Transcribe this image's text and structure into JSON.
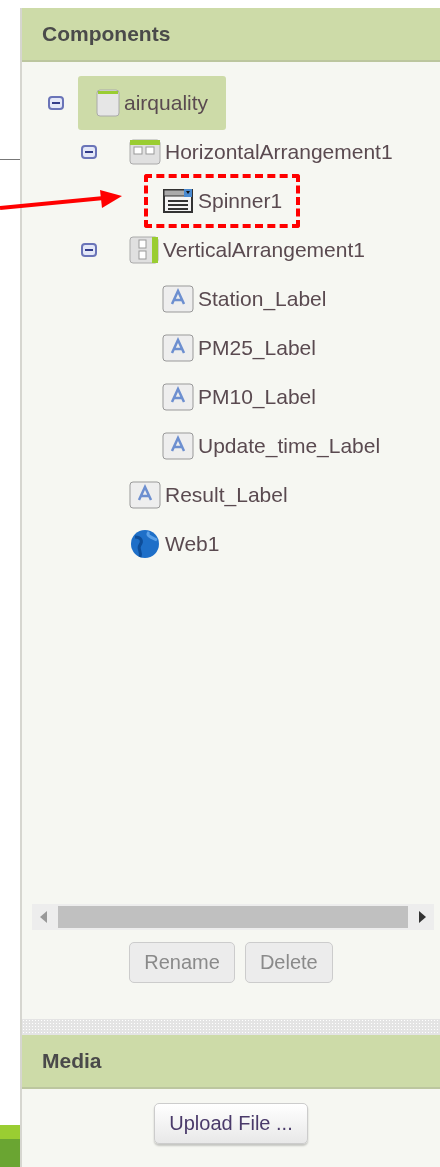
{
  "components": {
    "title": "Components",
    "tree": [
      {
        "label": "airquality",
        "kind": "screen",
        "selected": true,
        "expanded": true,
        "annotated": false,
        "children": [
          {
            "label": "HorizontalArrangement1",
            "kind": "horizontal",
            "selected": false,
            "expanded": true,
            "annotated": false,
            "children": [
              {
                "label": "Spinner1",
                "kind": "spinner",
                "selected": false,
                "annotated": true
              }
            ]
          },
          {
            "label": "VerticalArrangement1",
            "kind": "vertical",
            "selected": false,
            "expanded": true,
            "annotated": false,
            "children": [
              {
                "label": "Station_Label",
                "kind": "label",
                "selected": false,
                "annotated": false
              },
              {
                "label": "PM25_Label",
                "kind": "label",
                "selected": false,
                "annotated": false
              },
              {
                "label": "PM10_Label",
                "kind": "label",
                "selected": false,
                "annotated": false
              },
              {
                "label": "Update_time_Label",
                "kind": "label",
                "selected": false,
                "annotated": false
              }
            ]
          },
          {
            "label": "Result_Label",
            "kind": "label",
            "selected": false,
            "annotated": false
          },
          {
            "label": "Web1",
            "kind": "web",
            "selected": false,
            "annotated": false
          }
        ]
      }
    ],
    "buttons": [
      {
        "label": "Rename",
        "disabled": true
      },
      {
        "label": "Delete",
        "disabled": true
      }
    ]
  },
  "media": {
    "title": "Media",
    "buttons": [
      {
        "label": "Upload File ...",
        "disabled": false
      }
    ]
  }
}
